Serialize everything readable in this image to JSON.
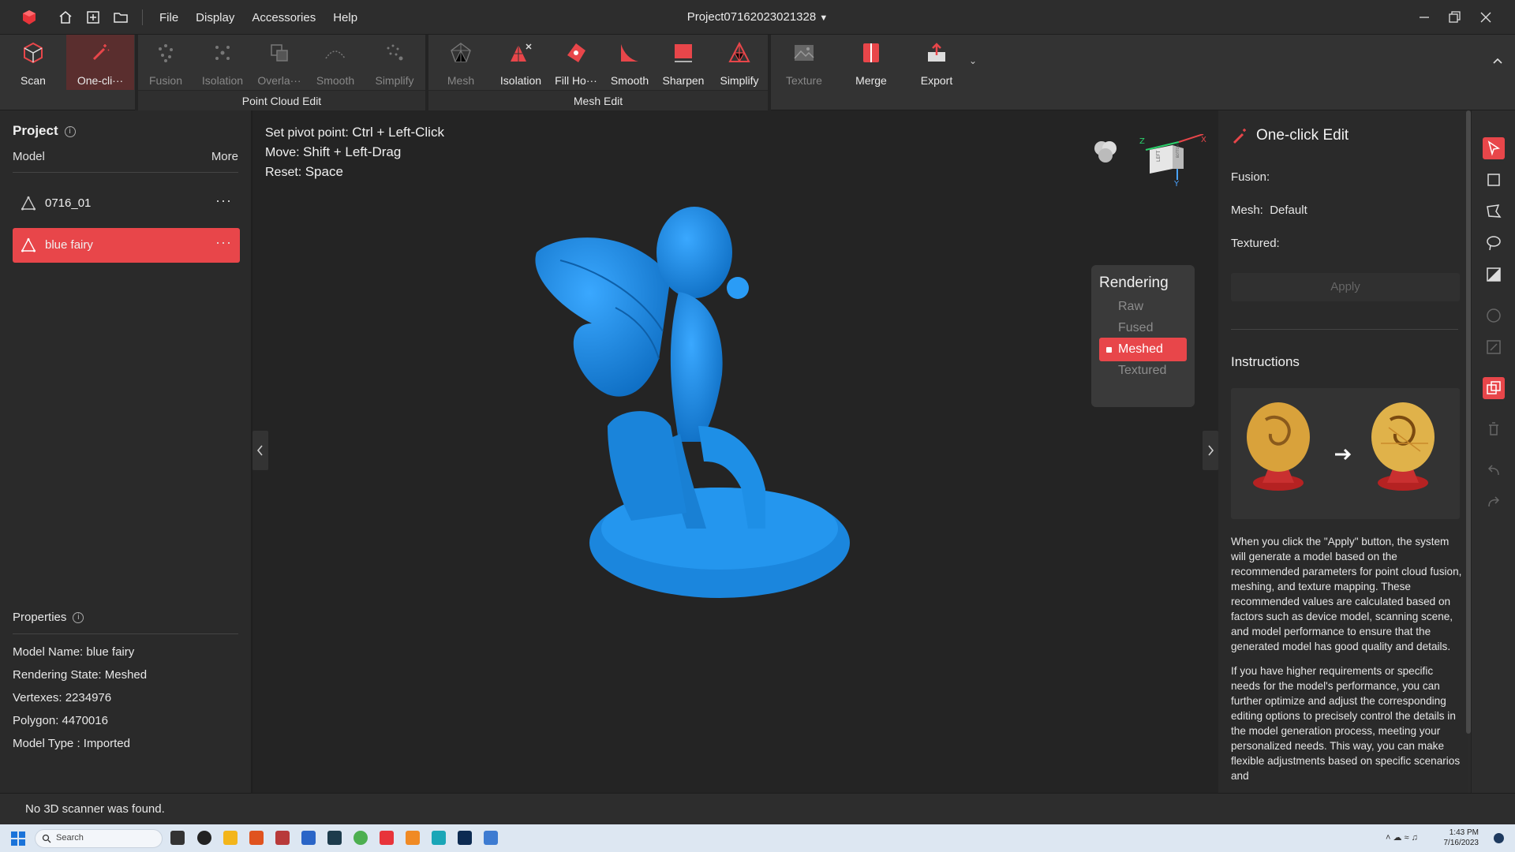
{
  "menu": {
    "file": "File",
    "display": "Display",
    "accessories": "Accessories",
    "help": "Help"
  },
  "project_title": "Project07162023021328",
  "ribbon": {
    "scan": "Scan",
    "one_click": "One-cli···",
    "pc_tools": [
      "Fusion",
      "Isolation",
      "Overla···",
      "Smooth",
      "Simplify"
    ],
    "pc_group": "Point Cloud Edit",
    "mesh_tools": [
      "Mesh",
      "Isolation",
      "Fill Ho···",
      "Smooth",
      "Sharpen",
      "Simplify"
    ],
    "mesh_group": "Mesh Edit",
    "texture": "Texture",
    "merge": "Merge",
    "export": "Export"
  },
  "left": {
    "project": "Project",
    "model": "Model",
    "more": "More",
    "models": [
      "0716_01",
      "blue fairy"
    ],
    "properties": "Properties",
    "props": [
      "Model Name:  blue fairy",
      "Rendering State:  Meshed",
      "Vertexes:  2234976",
      "Polygon:  4470016",
      "Model Type :  Imported"
    ]
  },
  "viewport": {
    "hint1_label": "Set pivot point:",
    "hint1_key": "Ctrl + Left-Click",
    "hint2_label": "Move:",
    "hint2_key": "Shift + Left-Drag",
    "hint3_label": "Reset:",
    "hint3_key": "Space",
    "rendering": "Rendering",
    "render_opts": [
      "Raw",
      "Fused",
      "Meshed",
      "Textured"
    ],
    "render_selected": "Meshed",
    "cube_face": "LEFT",
    "cube_side": "BOTTOM",
    "axes": {
      "x": "X",
      "y": "Y",
      "z": "Z"
    }
  },
  "right": {
    "title": "One-click Edit",
    "fusion": "Fusion:",
    "mesh_label": "Mesh:",
    "mesh_value": "Default",
    "textured": "Textured:",
    "apply": "Apply",
    "instructions": "Instructions",
    "para1": "When you click the \"Apply\" button, the system will generate a model based on the recommended parameters for point cloud fusion, meshing, and texture mapping. These recommended values are calculated based on factors such as device model, scanning scene, and model performance to ensure that the generated model has good quality and details.",
    "para2": "If you have higher requirements or specific needs for the model's performance, you can further optimize and adjust the corresponding editing options to precisely control the details in the model generation process, meeting your personalized needs. This way, you can make flexible adjustments based on specific scenarios and"
  },
  "status": "No 3D scanner was found.",
  "taskbar": {
    "search": "Search",
    "time": "1:43 PM",
    "date": "7/16/2023"
  },
  "colors": {
    "accent": "#e8464a",
    "model_blue": "#1e90e6"
  }
}
